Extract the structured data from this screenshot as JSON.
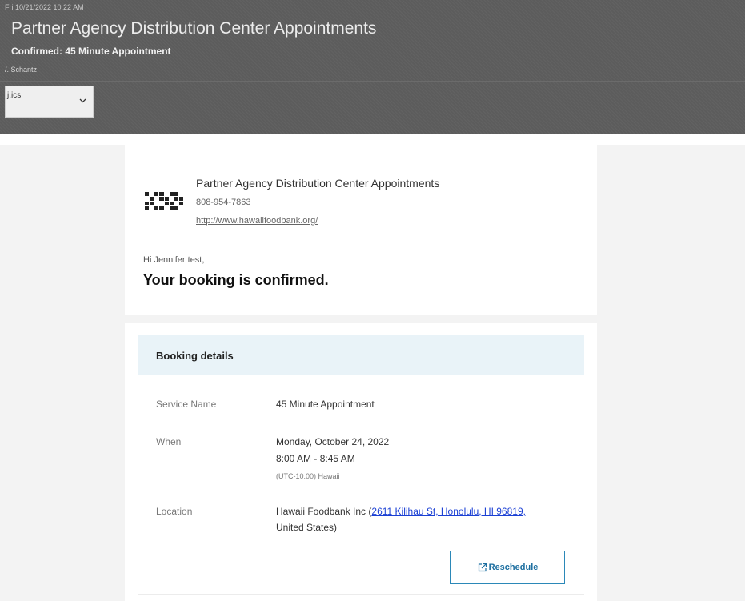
{
  "header": {
    "date": "Fri 10/21/2022 10:22 AM",
    "title": "Partner Agency Distribution Center Appointments",
    "subject": "Confirmed: 45 Minute Appointment",
    "from": "/. Schantz",
    "attachment": {
      "name": "j.ics",
      "icon": "chevron-down-icon"
    }
  },
  "organization": {
    "name": "Partner Agency Distribution Center Appointments",
    "phone": "808-954-7863",
    "website": "http://www.hawaiifoodbank.org/",
    "logo_icon": "qr-logo-icon"
  },
  "greeting": "Hi Jennifer test,",
  "confirmation": "Your booking is confirmed.",
  "booking": {
    "title": "Booking details",
    "service_label": "Service Name",
    "service_value": "45 Minute Appointment",
    "when_label": "When",
    "when_date": "Monday, October 24, 2022",
    "when_time": "8:00 AM - 8:45 AM",
    "when_timezone": "(UTC-10:00) Hawaii",
    "location_label": "Location",
    "location_name": "Hawaii Foodbank Inc (",
    "location_address": "2611 Kilihau St, Honolulu, HI 96819,",
    "location_country": "United States)"
  },
  "actions": {
    "reschedule_label": "Reschedule",
    "reschedule_icon": "external-link-icon"
  },
  "colors": {
    "header_bg": "#5c5c5c",
    "details_header_bg": "#e9f3f8",
    "accent": "#2b88b8",
    "link": "#1a3fd4"
  }
}
